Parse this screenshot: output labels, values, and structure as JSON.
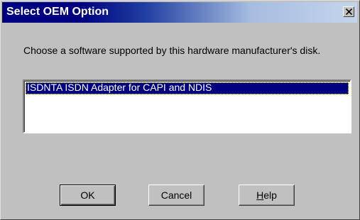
{
  "window": {
    "title": "Select OEM Option",
    "close_icon": "close-icon"
  },
  "prompt": "Choose a software supported by this hardware manufacturer's disk.",
  "list": {
    "items": [
      {
        "label": "ISDNTA ISDN Adapter for CAPI and NDIS",
        "selected": true
      }
    ]
  },
  "buttons": {
    "ok": "OK",
    "cancel": "Cancel",
    "help_mnemonic": "H",
    "help_rest": "elp"
  },
  "colors": {
    "face": "#c0c0c0",
    "title_bar": "#000080",
    "selection": "#000080"
  }
}
